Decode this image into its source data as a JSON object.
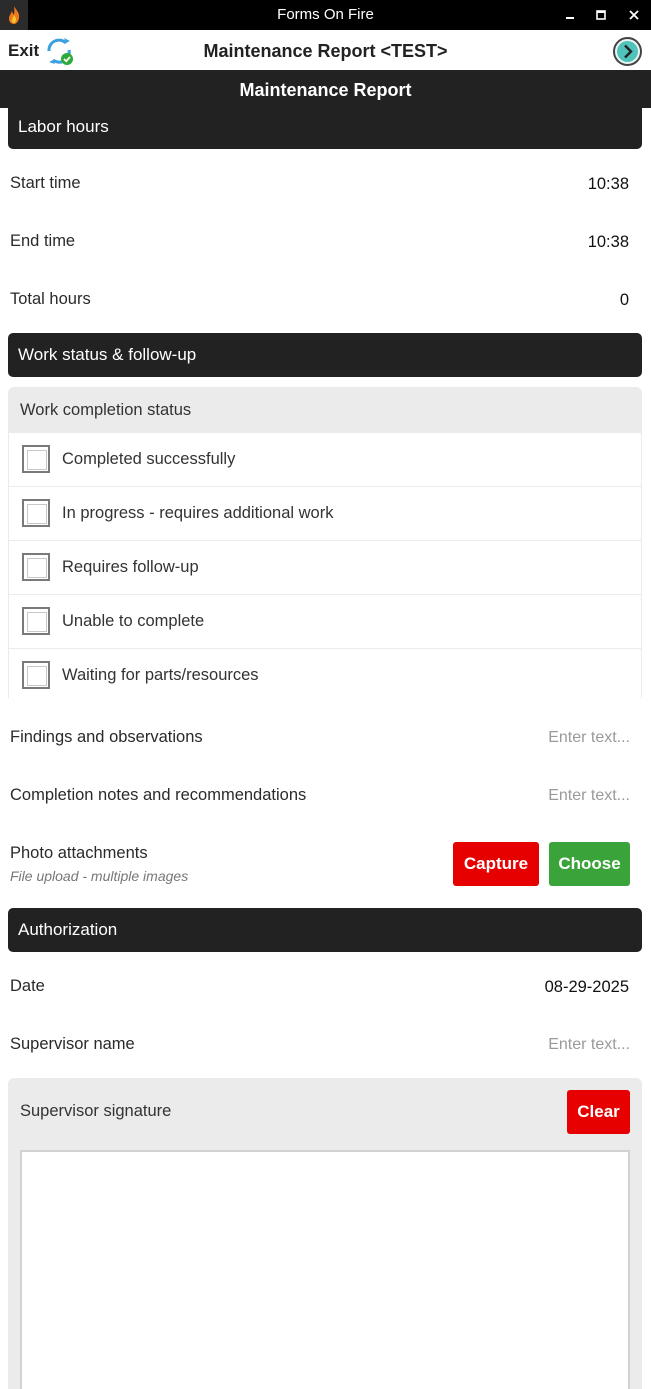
{
  "window": {
    "title": "Forms On Fire",
    "app_icon": "flame-icon",
    "controls": [
      "minimize-icon",
      "maximize-icon",
      "close-icon"
    ]
  },
  "toolbar": {
    "exit_label": "Exit",
    "sync_icon": "sync-icon",
    "form_title": "Maintenance Report <TEST>",
    "next_icon": "chevron-right-circle-icon"
  },
  "form": {
    "header": "Maintenance Report"
  },
  "labor": {
    "section_title": "Labor hours",
    "start_time_label": "Start time",
    "start_time_value": "10:38",
    "end_time_label": "End time",
    "end_time_value": "10:38",
    "total_hours_label": "Total hours",
    "total_hours_value": "0"
  },
  "work_status": {
    "section_title": "Work status & follow-up",
    "completion_title": "Work completion status",
    "options": [
      {
        "label": "Completed successfully",
        "checked": false
      },
      {
        "label": "In progress - requires additional work",
        "checked": false
      },
      {
        "label": "Requires follow-up",
        "checked": false
      },
      {
        "label": "Unable to complete",
        "checked": false
      },
      {
        "label": "Waiting for parts/resources",
        "checked": false
      }
    ],
    "findings_label": "Findings and observations",
    "findings_placeholder": "Enter text...",
    "notes_label": "Completion notes and recommendations",
    "notes_placeholder": "Enter text...",
    "photos_label": "Photo attachments",
    "photos_hint": "File upload - multiple images",
    "capture_label": "Capture",
    "choose_label": "Choose"
  },
  "authorization": {
    "section_title": "Authorization",
    "date_label": "Date",
    "date_value": "08-29-2025",
    "supervisor_label": "Supervisor name",
    "supervisor_placeholder": "Enter text...",
    "signature_label": "Supervisor signature",
    "clear_label": "Clear"
  },
  "colors": {
    "title_bar": "#000000",
    "section_header": "#222222",
    "capture_button": "#e60000",
    "choose_button": "#3aa43a",
    "clear_button": "#e60000",
    "sync_accent": "#3aa0e0",
    "sync_check": "#2eaa3a"
  }
}
